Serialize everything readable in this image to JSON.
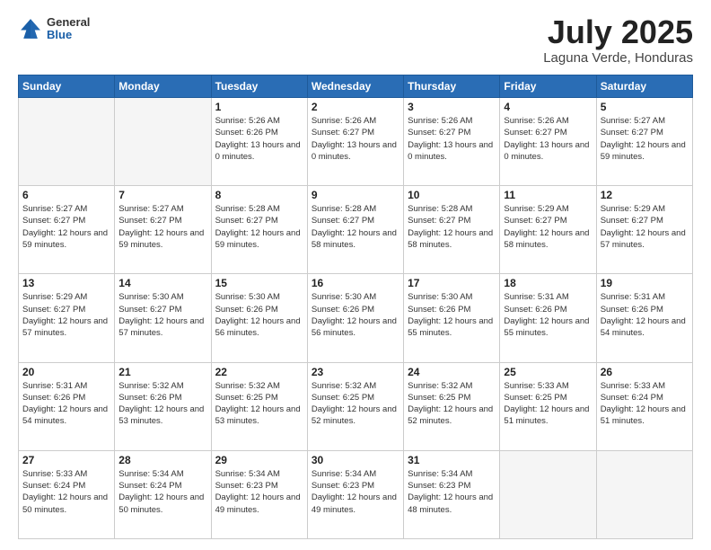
{
  "header": {
    "logo": {
      "general": "General",
      "blue": "Blue"
    },
    "title": "July 2025",
    "location": "Laguna Verde, Honduras"
  },
  "weekdays": [
    "Sunday",
    "Monday",
    "Tuesday",
    "Wednesday",
    "Thursday",
    "Friday",
    "Saturday"
  ],
  "weeks": [
    [
      {
        "day": "",
        "sunrise": "",
        "sunset": "",
        "daylight": "",
        "empty": true
      },
      {
        "day": "",
        "sunrise": "",
        "sunset": "",
        "daylight": "",
        "empty": true
      },
      {
        "day": "1",
        "sunrise": "Sunrise: 5:26 AM",
        "sunset": "Sunset: 6:26 PM",
        "daylight": "Daylight: 13 hours and 0 minutes."
      },
      {
        "day": "2",
        "sunrise": "Sunrise: 5:26 AM",
        "sunset": "Sunset: 6:27 PM",
        "daylight": "Daylight: 13 hours and 0 minutes."
      },
      {
        "day": "3",
        "sunrise": "Sunrise: 5:26 AM",
        "sunset": "Sunset: 6:27 PM",
        "daylight": "Daylight: 13 hours and 0 minutes."
      },
      {
        "day": "4",
        "sunrise": "Sunrise: 5:26 AM",
        "sunset": "Sunset: 6:27 PM",
        "daylight": "Daylight: 13 hours and 0 minutes."
      },
      {
        "day": "5",
        "sunrise": "Sunrise: 5:27 AM",
        "sunset": "Sunset: 6:27 PM",
        "daylight": "Daylight: 12 hours and 59 minutes."
      }
    ],
    [
      {
        "day": "6",
        "sunrise": "Sunrise: 5:27 AM",
        "sunset": "Sunset: 6:27 PM",
        "daylight": "Daylight: 12 hours and 59 minutes."
      },
      {
        "day": "7",
        "sunrise": "Sunrise: 5:27 AM",
        "sunset": "Sunset: 6:27 PM",
        "daylight": "Daylight: 12 hours and 59 minutes."
      },
      {
        "day": "8",
        "sunrise": "Sunrise: 5:28 AM",
        "sunset": "Sunset: 6:27 PM",
        "daylight": "Daylight: 12 hours and 59 minutes."
      },
      {
        "day": "9",
        "sunrise": "Sunrise: 5:28 AM",
        "sunset": "Sunset: 6:27 PM",
        "daylight": "Daylight: 12 hours and 58 minutes."
      },
      {
        "day": "10",
        "sunrise": "Sunrise: 5:28 AM",
        "sunset": "Sunset: 6:27 PM",
        "daylight": "Daylight: 12 hours and 58 minutes."
      },
      {
        "day": "11",
        "sunrise": "Sunrise: 5:29 AM",
        "sunset": "Sunset: 6:27 PM",
        "daylight": "Daylight: 12 hours and 58 minutes."
      },
      {
        "day": "12",
        "sunrise": "Sunrise: 5:29 AM",
        "sunset": "Sunset: 6:27 PM",
        "daylight": "Daylight: 12 hours and 57 minutes."
      }
    ],
    [
      {
        "day": "13",
        "sunrise": "Sunrise: 5:29 AM",
        "sunset": "Sunset: 6:27 PM",
        "daylight": "Daylight: 12 hours and 57 minutes."
      },
      {
        "day": "14",
        "sunrise": "Sunrise: 5:30 AM",
        "sunset": "Sunset: 6:27 PM",
        "daylight": "Daylight: 12 hours and 57 minutes."
      },
      {
        "day": "15",
        "sunrise": "Sunrise: 5:30 AM",
        "sunset": "Sunset: 6:26 PM",
        "daylight": "Daylight: 12 hours and 56 minutes."
      },
      {
        "day": "16",
        "sunrise": "Sunrise: 5:30 AM",
        "sunset": "Sunset: 6:26 PM",
        "daylight": "Daylight: 12 hours and 56 minutes."
      },
      {
        "day": "17",
        "sunrise": "Sunrise: 5:30 AM",
        "sunset": "Sunset: 6:26 PM",
        "daylight": "Daylight: 12 hours and 55 minutes."
      },
      {
        "day": "18",
        "sunrise": "Sunrise: 5:31 AM",
        "sunset": "Sunset: 6:26 PM",
        "daylight": "Daylight: 12 hours and 55 minutes."
      },
      {
        "day": "19",
        "sunrise": "Sunrise: 5:31 AM",
        "sunset": "Sunset: 6:26 PM",
        "daylight": "Daylight: 12 hours and 54 minutes."
      }
    ],
    [
      {
        "day": "20",
        "sunrise": "Sunrise: 5:31 AM",
        "sunset": "Sunset: 6:26 PM",
        "daylight": "Daylight: 12 hours and 54 minutes."
      },
      {
        "day": "21",
        "sunrise": "Sunrise: 5:32 AM",
        "sunset": "Sunset: 6:26 PM",
        "daylight": "Daylight: 12 hours and 53 minutes."
      },
      {
        "day": "22",
        "sunrise": "Sunrise: 5:32 AM",
        "sunset": "Sunset: 6:25 PM",
        "daylight": "Daylight: 12 hours and 53 minutes."
      },
      {
        "day": "23",
        "sunrise": "Sunrise: 5:32 AM",
        "sunset": "Sunset: 6:25 PM",
        "daylight": "Daylight: 12 hours and 52 minutes."
      },
      {
        "day": "24",
        "sunrise": "Sunrise: 5:32 AM",
        "sunset": "Sunset: 6:25 PM",
        "daylight": "Daylight: 12 hours and 52 minutes."
      },
      {
        "day": "25",
        "sunrise": "Sunrise: 5:33 AM",
        "sunset": "Sunset: 6:25 PM",
        "daylight": "Daylight: 12 hours and 51 minutes."
      },
      {
        "day": "26",
        "sunrise": "Sunrise: 5:33 AM",
        "sunset": "Sunset: 6:24 PM",
        "daylight": "Daylight: 12 hours and 51 minutes."
      }
    ],
    [
      {
        "day": "27",
        "sunrise": "Sunrise: 5:33 AM",
        "sunset": "Sunset: 6:24 PM",
        "daylight": "Daylight: 12 hours and 50 minutes."
      },
      {
        "day": "28",
        "sunrise": "Sunrise: 5:34 AM",
        "sunset": "Sunset: 6:24 PM",
        "daylight": "Daylight: 12 hours and 50 minutes."
      },
      {
        "day": "29",
        "sunrise": "Sunrise: 5:34 AM",
        "sunset": "Sunset: 6:23 PM",
        "daylight": "Daylight: 12 hours and 49 minutes."
      },
      {
        "day": "30",
        "sunrise": "Sunrise: 5:34 AM",
        "sunset": "Sunset: 6:23 PM",
        "daylight": "Daylight: 12 hours and 49 minutes."
      },
      {
        "day": "31",
        "sunrise": "Sunrise: 5:34 AM",
        "sunset": "Sunset: 6:23 PM",
        "daylight": "Daylight: 12 hours and 48 minutes."
      },
      {
        "day": "",
        "sunrise": "",
        "sunset": "",
        "daylight": "",
        "empty": true
      },
      {
        "day": "",
        "sunrise": "",
        "sunset": "",
        "daylight": "",
        "empty": true
      }
    ]
  ]
}
